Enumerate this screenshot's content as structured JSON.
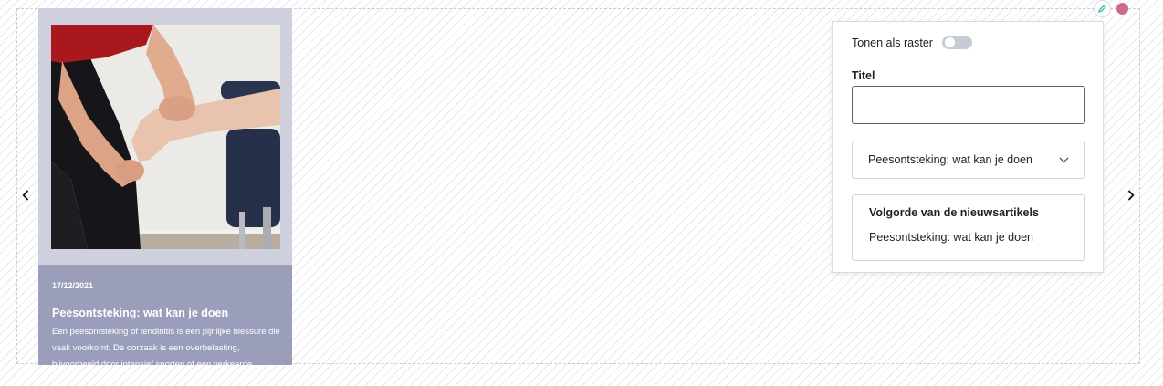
{
  "navigation": {
    "prev_icon": "chevron-left-icon",
    "next_icon": "chevron-right-icon"
  },
  "card": {
    "date": "17/12/2021",
    "title": "Peesontsteking: wat kan je doen",
    "excerpt": "Een peesontsteking of tendinitis is een pijnlijke blessure die vaak voorkomt. De oorzaak is een overbelasting, bijvoorbeeld door intensief sporten of een verkeerde beweging.",
    "image_subject": "physiotherapist examining a patient's foot and ankle",
    "background_color": "#cfd0dd",
    "body_color": "#9a9eba"
  },
  "toolbar": {
    "edit_icon": "pencil-icon",
    "status_color": "#cc6b8c"
  },
  "settings": {
    "grid_toggle_label": "Tonen als raster",
    "grid_toggle_on": false,
    "title_label": "Titel",
    "title_value": "",
    "article_select_value": "Peesontsteking: wat kan je doen",
    "order_heading": "Volgorde van de nieuwsartikels",
    "order_items": [
      "Peesontsteking: wat kan je doen"
    ]
  }
}
